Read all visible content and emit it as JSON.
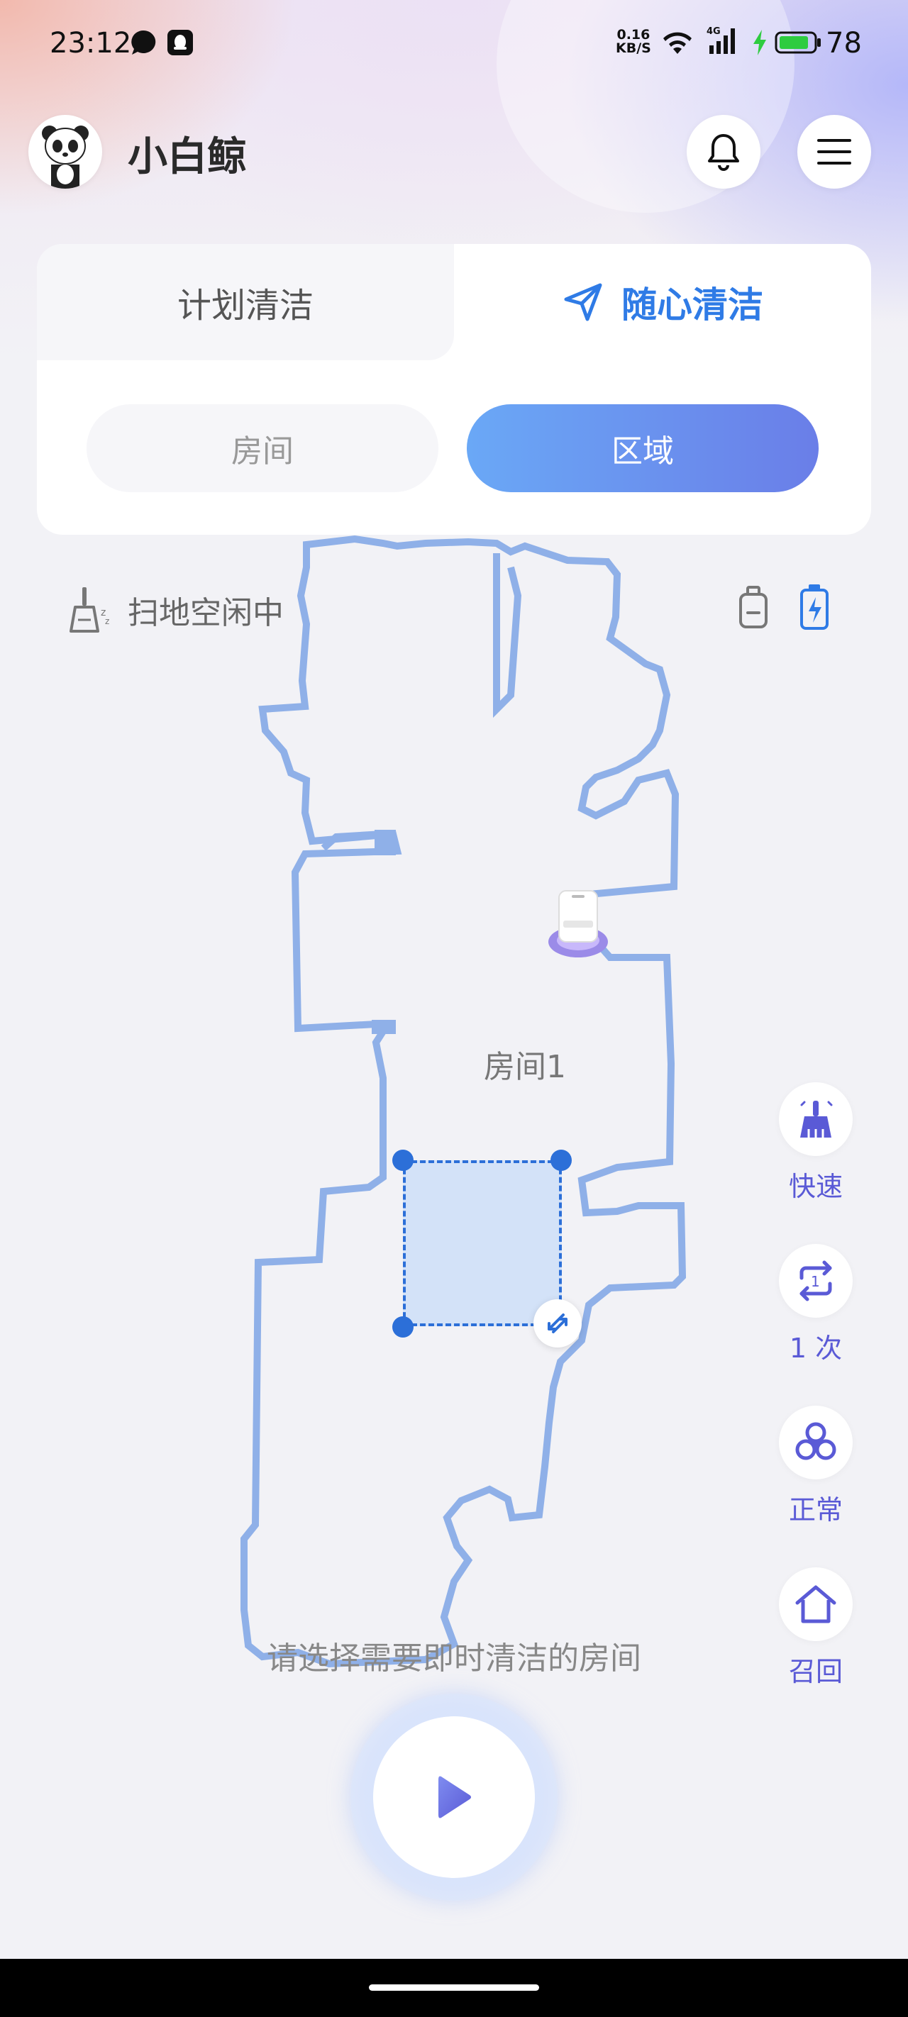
{
  "status_bar": {
    "time": "23:12",
    "speed_value": "0.16",
    "speed_unit": "KB/S",
    "network": "4G",
    "battery": "78",
    "icons": [
      "chat-icon",
      "qq-icon",
      "wifi-icon",
      "signal-icon",
      "charging-icon",
      "battery-icon"
    ]
  },
  "header": {
    "title": "小白鲸",
    "avatar_icon": "panda-icon",
    "bell_icon": "bell-icon",
    "menu_icon": "menu-icon"
  },
  "mode_tabs": {
    "plan_label": "计划清洁",
    "free_label": "随心清洁",
    "active": "随心清洁",
    "accent": "#2f7be6"
  },
  "segments": {
    "room_label": "房间",
    "zone_label": "区域",
    "active": "区域"
  },
  "robot_status": {
    "text": "扫地空闲中",
    "icons": [
      "broom-sleep-icon",
      "water-tank-icon",
      "battery-charging-icon"
    ]
  },
  "map": {
    "room_name": "房间1",
    "wall_color": "#8fb0e8",
    "zone_color": "#2c6fd8"
  },
  "controls": [
    {
      "label": "快速",
      "icon": "broom-icon"
    },
    {
      "label": "1 次",
      "icon": "repeat-once-icon"
    },
    {
      "label": "正常",
      "icon": "fan-icon"
    },
    {
      "label": "召回",
      "icon": "home-icon"
    }
  ],
  "hint": "请选择需要即时清洁的房间",
  "start_icon": "play-icon"
}
